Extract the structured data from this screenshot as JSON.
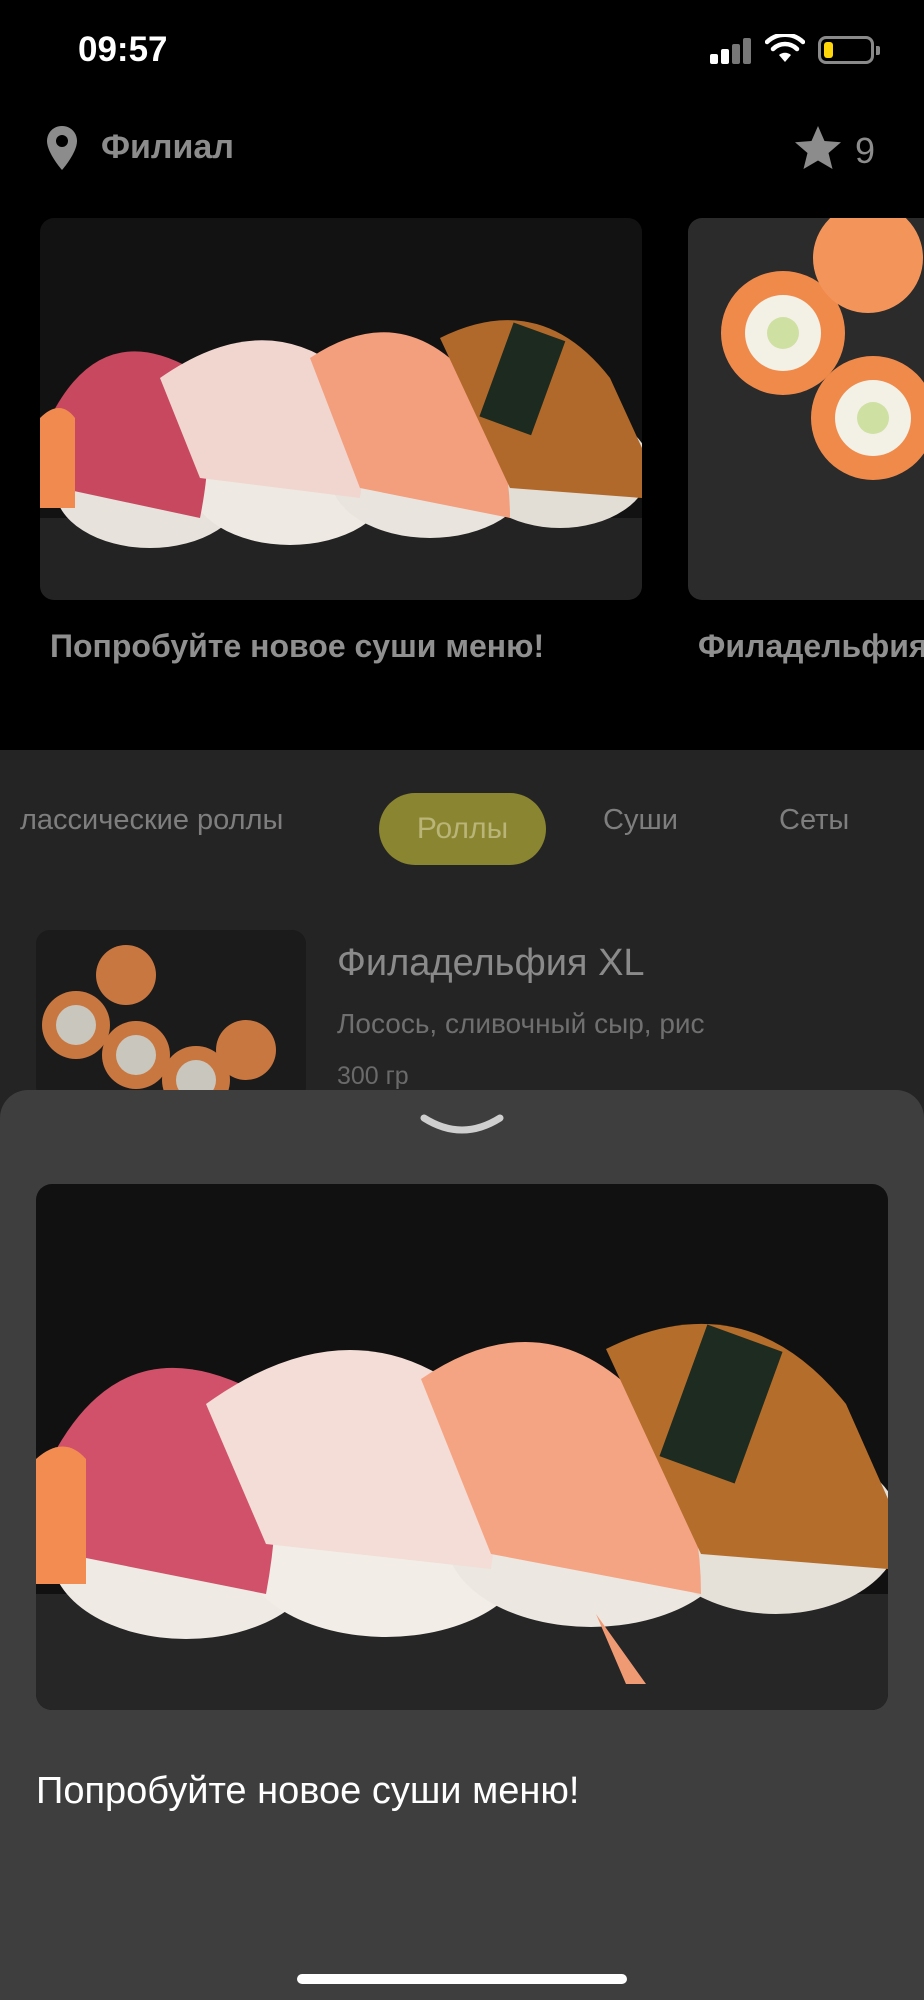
{
  "status_bar": {
    "time": "09:57",
    "icons": [
      "signal-icon",
      "wifi-icon",
      "battery-icon"
    ],
    "battery_color": "#ffd60a"
  },
  "header": {
    "location_icon": "map-pin-icon",
    "branch_label": "Филиал",
    "favorites_icon": "star-icon",
    "favorites_count": "9"
  },
  "carousel": {
    "slides": [
      {
        "caption": "Попробуйте новое суши меню!",
        "image": "nigiri-sushi-photo"
      },
      {
        "caption": "Филадельфия",
        "image": "philadelphia-roll-photo"
      }
    ],
    "active_index": 0,
    "dot_active_color": "#9a942f",
    "dot_inactive_color": "#a9a9a9"
  },
  "categories": {
    "tabs": [
      "лассические роллы",
      "Роллы",
      "Суши",
      "Сеты"
    ],
    "active": "Роллы",
    "accent": "#8a8530"
  },
  "product": {
    "title": "Филадельфия XL",
    "description": "Лосось, сливочный сыр, рис",
    "weight": "300 гр",
    "image": "philadelphia-roll-photo"
  },
  "sheet": {
    "handle_icon": "chevron-down-icon",
    "image": "nigiri-sushi-photo",
    "title": "Попробуйте новое суши меню!"
  }
}
